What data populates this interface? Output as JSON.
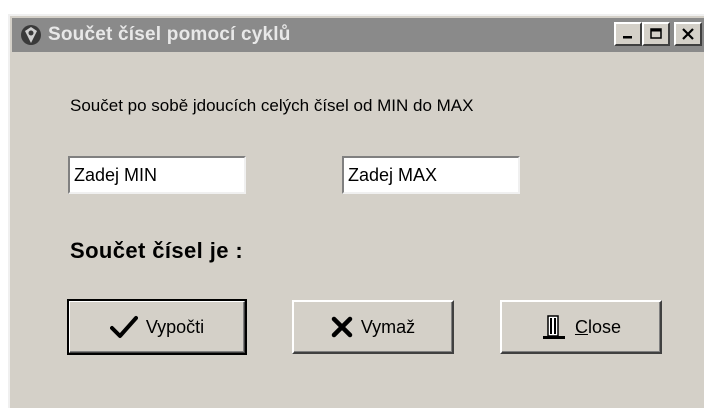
{
  "window": {
    "title": "Součet čísel pomocí cyklů",
    "minimize_label": "_",
    "maximize_label": "□",
    "close_label": "✕"
  },
  "form": {
    "caption": "Součet po sobě jdoucích celých čísel  od MIN do MAX",
    "min_value": "Zadej MIN",
    "max_value": "Zadej MAX",
    "result_label": "Součet čísel je :"
  },
  "buttons": {
    "calc_label": "Vypočti",
    "clear_label": "Vymaž",
    "close_label": "Close"
  },
  "icons": {
    "app": "app-icon",
    "calc": "checkmark-icon",
    "clear": "x-icon",
    "close": "door-icon"
  }
}
